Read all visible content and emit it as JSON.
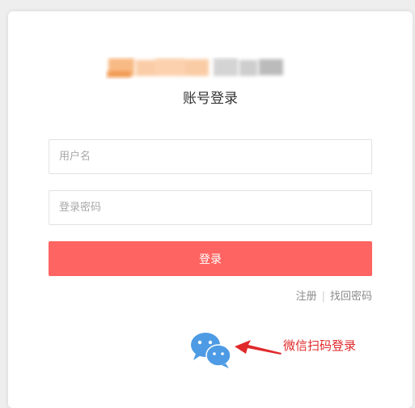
{
  "login": {
    "title": "账号登录",
    "username_placeholder": "用户名",
    "password_placeholder": "登录密码",
    "submit_label": "登录",
    "register_label": "注册",
    "separator": "|",
    "forgot_label": "找回密码"
  },
  "wechat": {
    "annotation": "微信扫码登录"
  },
  "colors": {
    "primary": "#fe6461",
    "wechat_blue": "#4d9be4",
    "annotation_red": "#e0292b"
  },
  "icons": [
    "blurred-logo",
    "wechat-icon",
    "arrow-pointer"
  ]
}
